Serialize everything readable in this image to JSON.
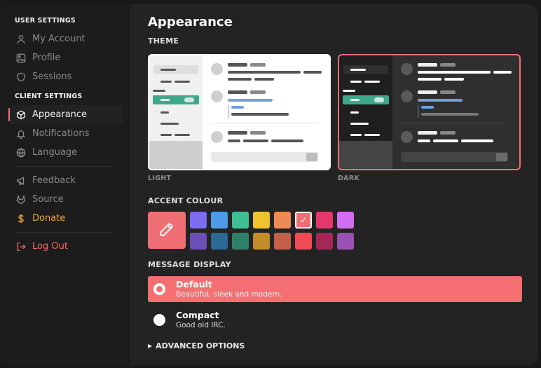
{
  "sidebar": {
    "user_settings_title": "USER SETTINGS",
    "client_settings_title": "CLIENT SETTINGS",
    "items": [
      {
        "label": "My Account",
        "icon": "user-icon"
      },
      {
        "label": "Profile",
        "icon": "image-icon"
      },
      {
        "label": "Sessions",
        "icon": "shield-icon"
      },
      {
        "label": "Appearance",
        "icon": "cube-icon",
        "active": true
      },
      {
        "label": "Notifications",
        "icon": "bell-icon"
      },
      {
        "label": "Language",
        "icon": "globe-icon"
      },
      {
        "label": "Feedback",
        "icon": "megaphone-icon"
      },
      {
        "label": "Source",
        "icon": "gitlab-icon"
      },
      {
        "label": "Donate",
        "icon": "dollar-icon"
      },
      {
        "label": "Log Out",
        "icon": "logout-icon"
      }
    ]
  },
  "main": {
    "title": "Appearance",
    "theme_label": "THEME",
    "themes": [
      {
        "caption": "LIGHT"
      },
      {
        "caption": "DARK",
        "selected": true
      }
    ],
    "accent_label": "ACCENT COLOUR",
    "accent_colors": [
      "#7c6cf0",
      "#4d9be6",
      "#3fbf94",
      "#efc22e",
      "#f08a55",
      "#f06f75",
      "#e4376b",
      "#d26ef0",
      "#6a4fb4",
      "#2e6897",
      "#2f8068",
      "#c38c28",
      "#c2604a",
      "#ef4a55",
      "#a32857",
      "#9b50b4"
    ],
    "selected_accent": "#f06f75",
    "message_label": "MESSAGE DISPLAY",
    "message_options": [
      {
        "title": "Default",
        "desc": "Beautiful, sleek and modern.",
        "selected": true
      },
      {
        "title": "Compact",
        "desc": "Good old IRC.",
        "selected": false
      }
    ],
    "advanced_label": "ADVANCED OPTIONS"
  }
}
